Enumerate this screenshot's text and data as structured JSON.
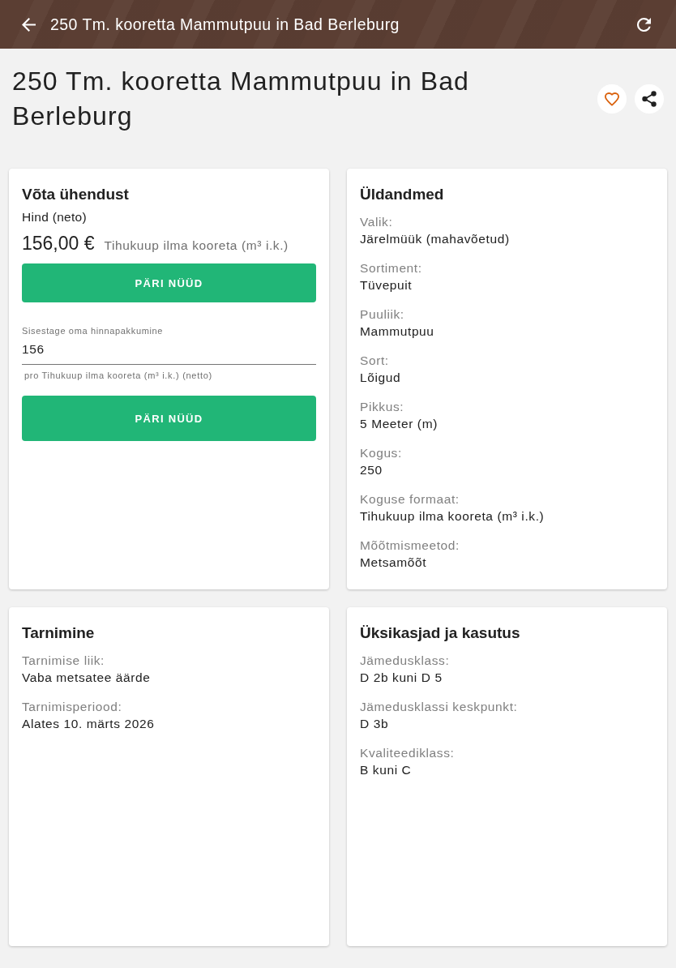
{
  "app_bar": {
    "title": "250 Tm. kooretta Mammutpuu in Bad Berleburg"
  },
  "heading": "250 Tm. kooretta Mammutpuu in Bad Berleburg",
  "favorite": {
    "on": false
  },
  "contact_card": {
    "title": "Võta ühendust",
    "price_label": "Hind (neto)",
    "price": "156,00 €",
    "price_unit": "Tihukuup ilma kooreta (m³ i.k.)",
    "request_button": "PÄRI NÜÜD",
    "offer_field": {
      "label": "Sisestage oma hinnapakkumine",
      "value": "156",
      "hint": "pro Tihukuup ilma kooreta (m³ i.k.) (netto)"
    },
    "offer_button": "PÄRI NÜÜD"
  },
  "detail_cards": [
    {
      "title": "Üldandmed",
      "fields": [
        {
          "label": "Valik:",
          "value": "Järelmüük (mahavõetud)"
        },
        {
          "label": "Sortiment:",
          "value": "Tüvepuit"
        },
        {
          "label": "Puuliik:",
          "value": "Mammutpuu"
        },
        {
          "label": "Sort:",
          "value": "Lõigud"
        },
        {
          "label": "Pikkus:",
          "value": "5 Meeter (m)"
        },
        {
          "label": "Kogus:",
          "value": "250"
        },
        {
          "label": "Koguse formaat:",
          "value": "Tihukuup ilma kooreta (m³ i.k.)"
        },
        {
          "label": "Mõõtmismeetod:",
          "value": "Metsamõõt"
        }
      ]
    },
    {
      "title": "Tarnimine",
      "fields": [
        {
          "label": "Tarnimise liik:",
          "value": "Vaba metsatee äärde"
        },
        {
          "label": "Tarnimisperiood:",
          "value": "Alates 10. märts 2026"
        }
      ]
    },
    {
      "title": "Üksikasjad ja kasutus",
      "fields": [
        {
          "label": "Jämedusklass:",
          "value": "D 2b kuni D 5"
        },
        {
          "label": "Jämedusklassi keskpunkt:",
          "value": "D 3b"
        },
        {
          "label": "Kvaliteediklass:",
          "value": "B kuni C"
        }
      ]
    }
  ]
}
